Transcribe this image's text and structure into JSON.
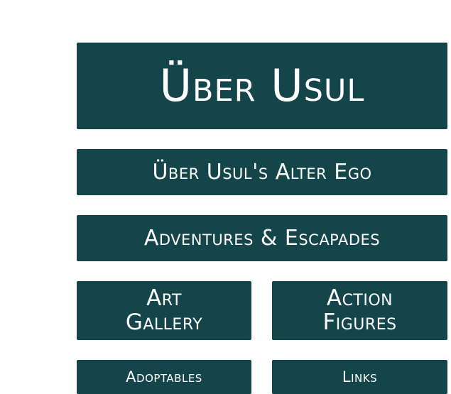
{
  "header": {
    "title": "Über Usul"
  },
  "nav": {
    "alter_ego": "Über Usul's Alter Ego",
    "adventures": "Adventures & Escapades",
    "art_gallery": {
      "line1": "Art",
      "line2": "Gallery"
    },
    "action_figures": {
      "line1": "Action",
      "line2": "Figures"
    },
    "adoptables": "Adoptables",
    "links": "Links"
  },
  "colors": {
    "tile_background": "#13454a",
    "tile_text": "#ffffff",
    "page_background": "#ffffff"
  }
}
